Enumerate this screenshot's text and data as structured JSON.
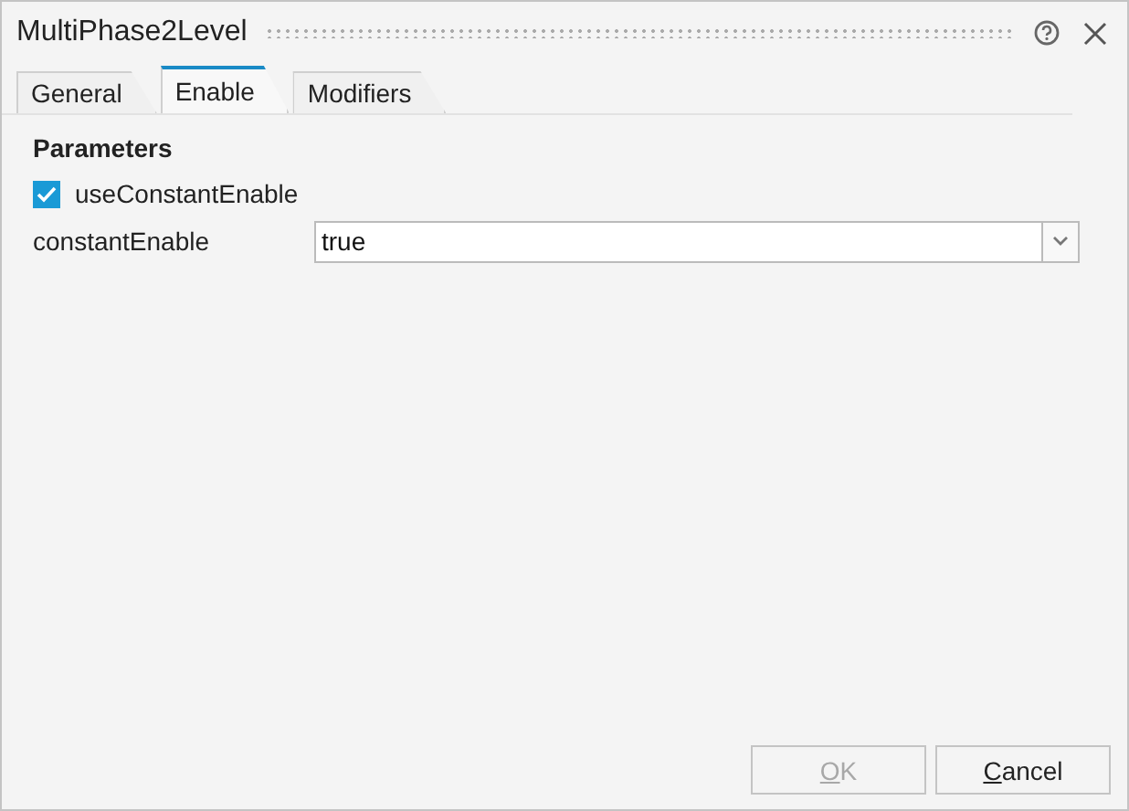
{
  "window": {
    "title": "MultiPhase2Level"
  },
  "tabs": [
    {
      "label": "General",
      "selected": false
    },
    {
      "label": "Enable",
      "selected": true
    },
    {
      "label": "Modifiers",
      "selected": false
    }
  ],
  "section": "Parameters",
  "checkbox": {
    "label": "useConstantEnable",
    "checked": true
  },
  "field": {
    "label": "constantEnable",
    "value": "true"
  },
  "buttons": [
    {
      "label": "OK",
      "disabled": true
    },
    {
      "label": "Cancel",
      "disabled": false
    }
  ]
}
